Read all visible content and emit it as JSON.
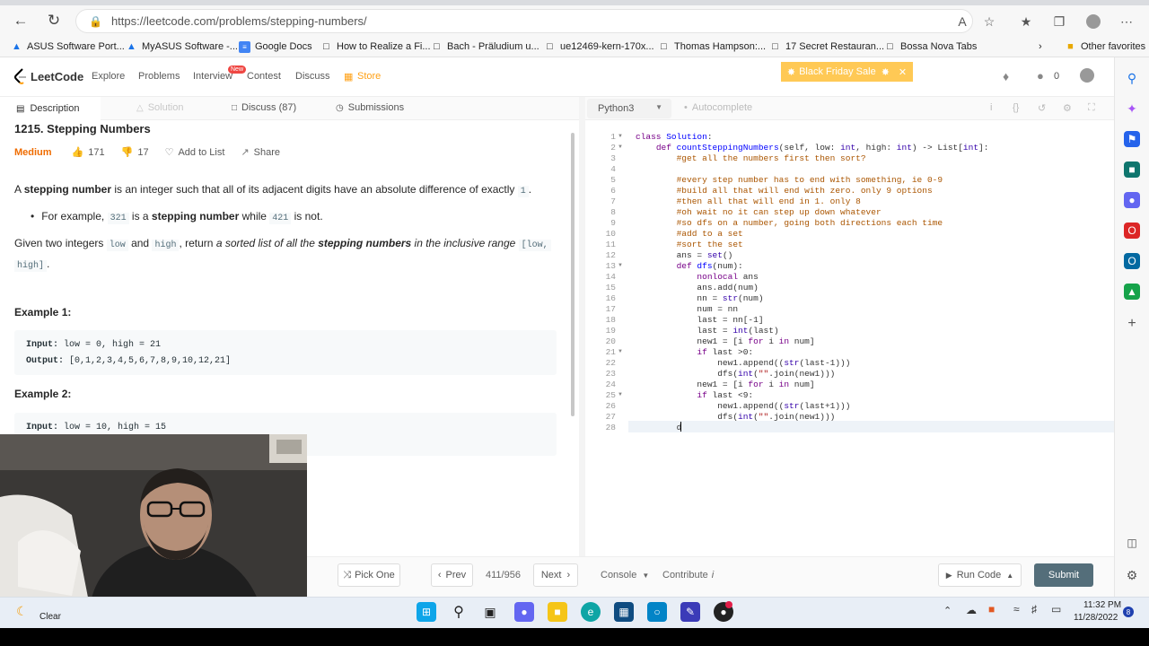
{
  "browser": {
    "url": "https://leetcode.com/problems/stepping-numbers/",
    "bookmarks": [
      "ASUS Software Port...",
      "MyASUS Software -...",
      "Google Docs",
      "How to Realize a Fi...",
      "Bach - Präludium u...",
      "ue12469-kern-170x...",
      "Thomas Hampson:...",
      "17 Secret Restauran...",
      "Bossa Nova Tabs"
    ],
    "other_favorites": "Other favorites"
  },
  "nav": {
    "logo": "LeetCode",
    "items": [
      "Explore",
      "Problems",
      "Interview",
      "Contest",
      "Discuss",
      "Store"
    ],
    "new_badge": "New",
    "sale_banner": "Black Friday Sale",
    "points": "0"
  },
  "tabs": {
    "description": "Description",
    "solution": "Solution",
    "discuss": "Discuss (87)",
    "submissions": "Submissions"
  },
  "problem": {
    "title": "1215. Stepping Numbers",
    "difficulty": "Medium",
    "likes": "171",
    "dislikes": "17",
    "add_to_list": "Add to List",
    "share": "Share",
    "p1_a": "A ",
    "p1_b": "stepping number",
    "p1_c": " is an integer such that all of its adjacent digits have an absolute difference of exactly ",
    "p1_code": "1",
    "p1_d": ".",
    "bullet_a": "For example, ",
    "bullet_code1": "321",
    "bullet_b": " is a ",
    "bullet_bold": "stepping number",
    "bullet_c": " while ",
    "bullet_code2": "421",
    "bullet_d": " is not.",
    "p2_a": "Given two integers ",
    "p2_code1": "low",
    "p2_b": " and ",
    "p2_code2": "high",
    "p2_c": ", return ",
    "p2_italic1": "a sorted list of all the ",
    "p2_bold": "stepping numbers",
    "p2_italic2": " in the inclusive range ",
    "p2_code3": "[low,",
    "p2_code4": "high]",
    "p2_d": ".",
    "example1_heading": "Example 1:",
    "example1_input_label": "Input:",
    "example1_input": " low = 0, high = 21",
    "example1_output_label": "Output:",
    "example1_output": " [0,1,2,3,4,5,6,7,8,9,10,12,21]",
    "example2_heading": "Example 2:",
    "example2_input_label": "Input:",
    "example2_input": " low = 10, high = 15"
  },
  "editor": {
    "language": "Python3",
    "autocomplete": "Autocomplete"
  },
  "bottom": {
    "pick_one": "Pick One",
    "prev": "Prev",
    "counter": "411/956",
    "next": "Next",
    "console": "Console",
    "contribute": "Contribute",
    "run_code": "Run Code",
    "submit": "Submit"
  },
  "taskbar": {
    "weather": "Clear",
    "time": "11:32 PM",
    "date": "11/28/2022",
    "notifications": "8"
  }
}
